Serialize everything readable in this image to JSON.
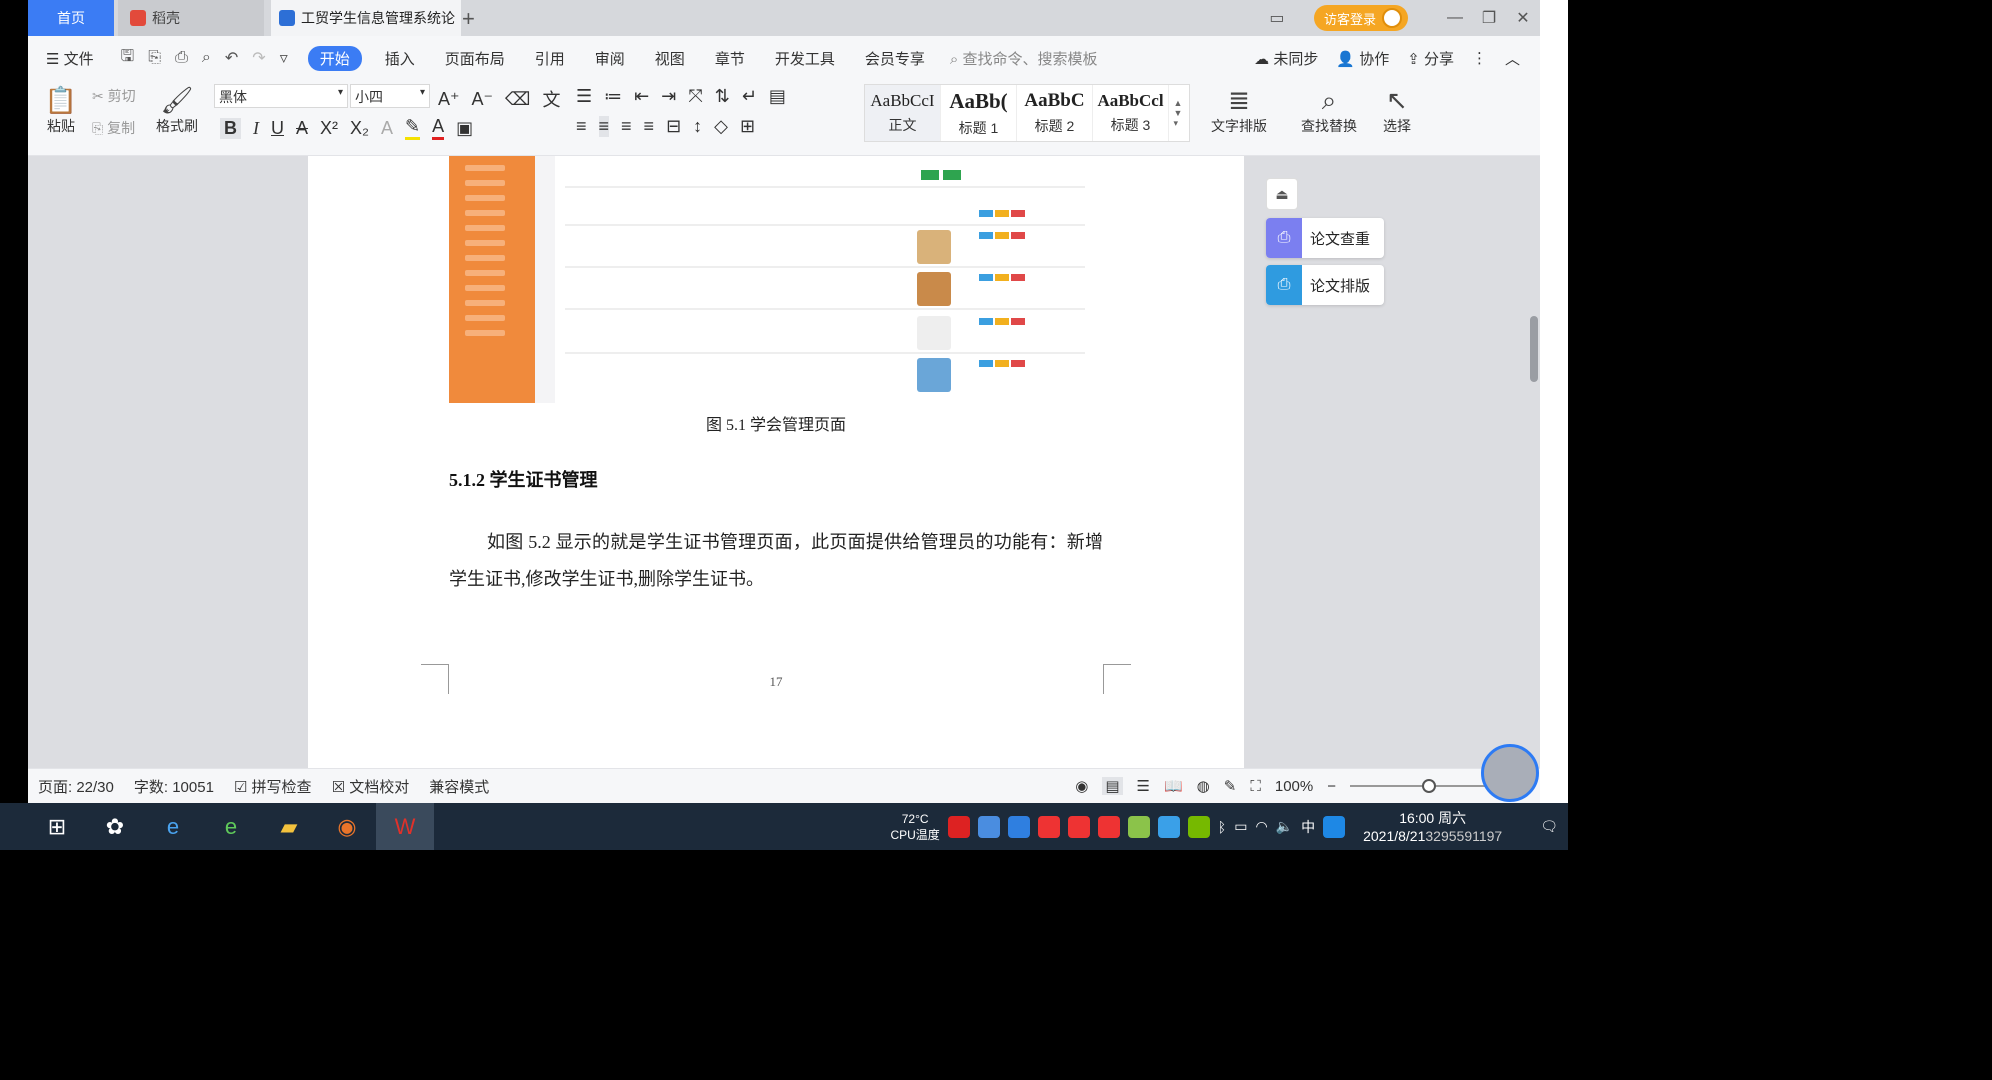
{
  "tabs": {
    "home": "首页",
    "daoke": "稻壳",
    "doc": "工贸学生信息管理系统论"
  },
  "titlebar": {
    "visitor_login": "访客登录"
  },
  "menu": {
    "file": "文件",
    "items": [
      "开始",
      "插入",
      "页面布局",
      "引用",
      "审阅",
      "视图",
      "章节",
      "开发工具",
      "会员专享"
    ],
    "search_placeholder": "查找命令、搜索模板",
    "not_synced": "未同步",
    "collab": "协作",
    "share": "分享"
  },
  "ribbon": {
    "paste": "粘贴",
    "cut": "剪切",
    "copy": "复制",
    "format_painter": "格式刷",
    "font_name": "黑体",
    "font_size": "小四",
    "styles": [
      {
        "preview": "AaBbCcI",
        "name": "正文"
      },
      {
        "preview": "AaBb(",
        "name": "标题 1"
      },
      {
        "preview": "AaBbC",
        "name": "标题 2"
      },
      {
        "preview": "AaBbCcl",
        "name": "标题 3"
      }
    ],
    "text_layout": "文字排版",
    "find_replace": "查找替换",
    "select": "选择"
  },
  "document": {
    "figure_caption": "图 5.1  学会管理页面",
    "heading": "5.1.2  学生证书管理",
    "paragraph": "如图 5.2 显示的就是学生证书管理页面，此页面提供给管理员的功能有：新增学生证书,修改学生证书,删除学生证书。",
    "page_number": "17"
  },
  "side_panel": {
    "check": "论文查重",
    "layout": "论文排版"
  },
  "statusbar": {
    "page": "页面: 22/30",
    "words": "字数: 10051",
    "spell": "拼写检查",
    "proof": "文档校对",
    "compat": "兼容模式",
    "zoom": "100%"
  },
  "taskbar": {
    "temp": "72°C",
    "cpu": "CPU温度",
    "ime": "中",
    "time": "16:00 周六",
    "date": "2021/8/21",
    "watermark": "3295591197"
  },
  "colors": {
    "accent": "#3b7cf4",
    "sidebar_orange": "#f08a3c"
  }
}
